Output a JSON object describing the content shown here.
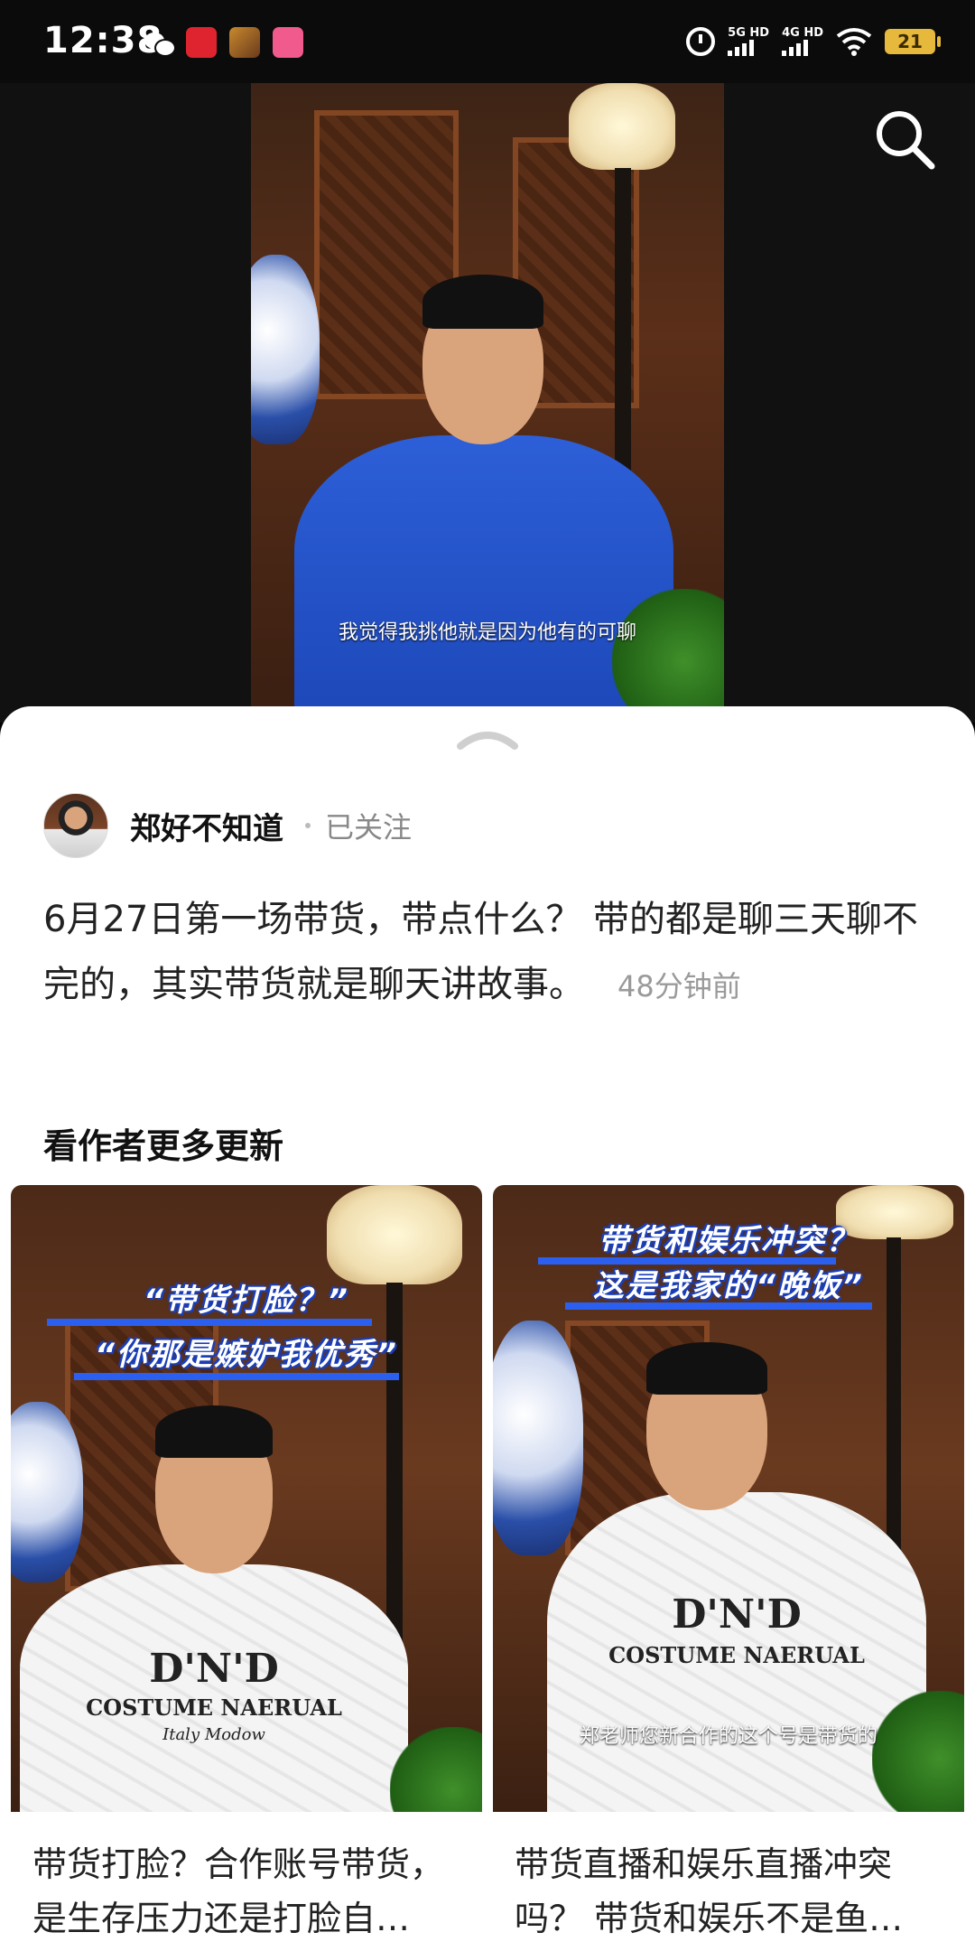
{
  "status_bar": {
    "time": "12:38",
    "network_1": "5G HD",
    "network_2": "4G HD",
    "battery": "21",
    "notification_icons": [
      "wechat-icon",
      "netease-music-icon",
      "game-icon",
      "bilibili-icon"
    ]
  },
  "video": {
    "subtitle": "我觉得我挑他就是因为他有的可聊"
  },
  "post": {
    "author_name": "郑好不知道",
    "follow_status": "已关注",
    "text": "6月27日第一场带货，带点什么？ 带的都是聊三天聊不完的，其实带货就是聊天讲故事。",
    "time": "48分钟前"
  },
  "more_section": {
    "title": "看作者更多更新",
    "cards": [
      {
        "caption_line1": "“带货打脸？”",
        "caption_line2": "“你那是嫉妒我优秀”",
        "shirt_text": "D'N'D",
        "shirt_subtext": "COSTUME NAERUAL",
        "shirt_script": "Italy Modow",
        "title": "带货打脸？合作账号带货，是生存压力还是打脸自…"
      },
      {
        "caption_line1": "带货和娱乐冲突？",
        "caption_line2": "这是我家的“晚饭”",
        "shirt_text": "D'N'D",
        "shirt_subtext": "COSTUME NAERUAL",
        "subtitle": "郑老师您新合作的这个号是带货的",
        "title": "带货直播和娱乐直播冲突吗？ 带货和娱乐不是鱼…"
      }
    ]
  },
  "colors": {
    "status_bar_bg": "#0b0b0b",
    "sheet_bg": "#ffffff",
    "caption_blue": "#2b5ff0",
    "battery": "#e6b83c"
  }
}
